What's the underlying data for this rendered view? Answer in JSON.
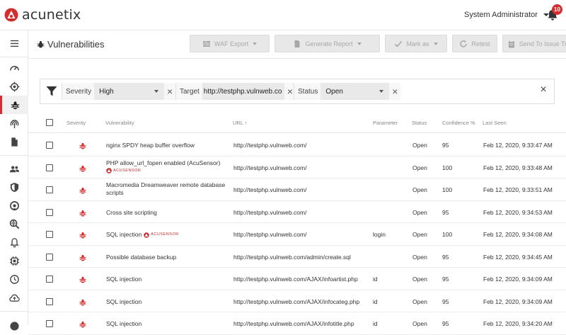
{
  "app": {
    "logo_text": "acunetix",
    "user_label": "System Administrator",
    "notifications_count": "10"
  },
  "page": {
    "title": "Vulnerabilities"
  },
  "toolbar": {
    "waf_export": "WAF Export",
    "generate_report": "Generate Report",
    "mark_as": "Mark as",
    "retest": "Retest",
    "send_to_tracker": "Send To Issue Tracker"
  },
  "filters": {
    "severity_label": "Severity",
    "severity_value": "High",
    "target_label": "Target",
    "target_value": "http://testphp.vulnweb.co",
    "status_label": "Status",
    "status_value": "Open"
  },
  "table": {
    "headers": {
      "severity": "Severity",
      "vulnerability": "Vulnerability",
      "url": "URL ↑",
      "parameter": "Parameter",
      "status": "Status",
      "confidence": "Confidence %",
      "last_seen": "Last Seen"
    },
    "acusensor_label": "ACUSENSOR",
    "rows": [
      {
        "vulnerability": "nginx SPDY heap buffer overflow",
        "url": "http://testphp.vulnweb.com/",
        "parameter": "",
        "status": "Open",
        "confidence": "95",
        "last_seen": "Feb 12, 2020, 9:33:47 AM"
      },
      {
        "vulnerability": "PHP allow_url_fopen enabled (AcuSensor)",
        "url": "http://testphp.vulnweb.com/",
        "parameter": "",
        "status": "Open",
        "confidence": "100",
        "last_seen": "Feb 12, 2020, 9:33:48 AM"
      },
      {
        "vulnerability": "Macromedia Dreamweaver remote database",
        "vulnerability_line2": "scripts",
        "url": "http://testphp.vulnweb.com/",
        "parameter": "",
        "status": "Open",
        "confidence": "100",
        "last_seen": "Feb 12, 2020, 9:33:51 AM"
      },
      {
        "vulnerability": "Cross site scripting",
        "url": "http://testphp.vulnweb.com/",
        "parameter": "",
        "status": "Open",
        "confidence": "95",
        "last_seen": "Feb 12, 2020, 9:34:53 AM"
      },
      {
        "vulnerability": "SQL injection",
        "url": "http://testphp.vulnweb.com/",
        "parameter": "login",
        "status": "Open",
        "confidence": "100",
        "last_seen": "Feb 12, 2020, 9:34:08 AM"
      },
      {
        "vulnerability": "Possible database backup",
        "url": "http://testphp.vulnweb.com/admin/create.sql",
        "parameter": "",
        "status": "Open",
        "confidence": "95",
        "last_seen": "Feb 12, 2020, 9:34:45 AM"
      },
      {
        "vulnerability": "SQL injection",
        "url": "http://testphp.vulnweb.com/AJAX/infoartist.php",
        "parameter": "id",
        "status": "Open",
        "confidence": "95",
        "last_seen": "Feb 12, 2020, 9:34:09 AM"
      },
      {
        "vulnerability": "SQL injection",
        "url": "http://testphp.vulnweb.com/AJAX/infocateg.php",
        "parameter": "id",
        "status": "Open",
        "confidence": "95",
        "last_seen": "Feb 12, 2020, 9:34:09 AM"
      },
      {
        "vulnerability": "SQL injection",
        "url": "http://testphp.vulnweb.com/AJAX/infotitle.php",
        "parameter": "id",
        "status": "Open",
        "confidence": "95",
        "last_seen": "Feb 12, 2020, 9:34:20 AM"
      }
    ]
  },
  "colors": {
    "accent": "#d32d2d",
    "disabled_button": "#e8e8e8"
  }
}
